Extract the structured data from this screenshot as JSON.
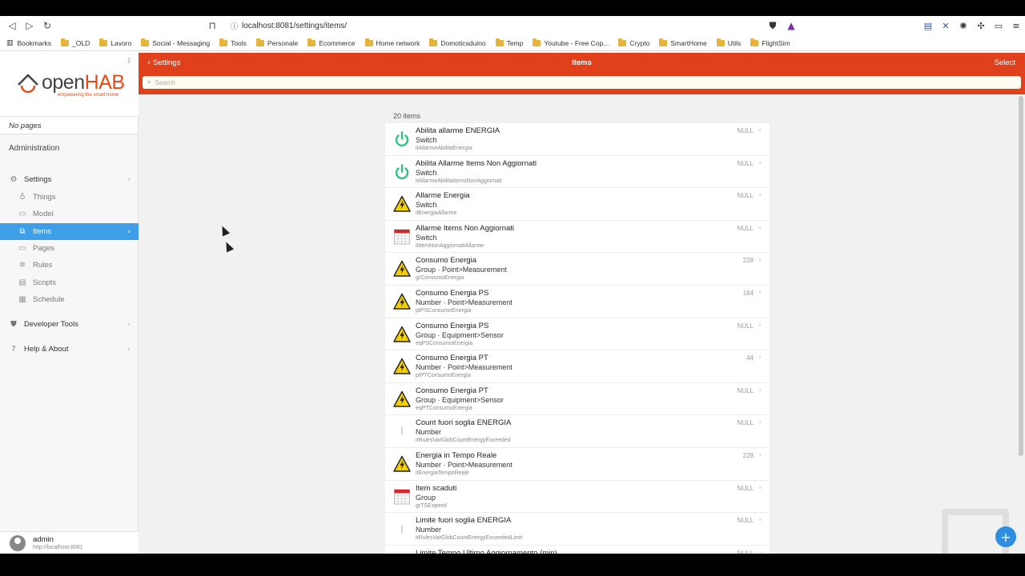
{
  "browser": {
    "url": "localhost:8081/settings/items/",
    "bookmarks": [
      "Bookmarks",
      "_OLD",
      "Lavoro",
      "Social - Messaging",
      "Tools",
      "Personale",
      "Ecommerce",
      "Home network",
      "Domoticsduino",
      "Temp",
      "Youtube - Free Cop...",
      "Crypto",
      "SmartHome",
      "Utils",
      "FlightSim"
    ]
  },
  "sidebar": {
    "logo_prefix": "open",
    "logo_suffix": "HAB",
    "logo_tagline": "empowering the smart home",
    "no_pages": "No pages",
    "section_title": "Administration",
    "settings_label": "Settings",
    "sub_items": [
      {
        "label": "Things",
        "icon": "bulb-icon"
      },
      {
        "label": "Model",
        "icon": "model-icon"
      },
      {
        "label": "Items",
        "icon": "items-icon"
      },
      {
        "label": "Pages",
        "icon": "pages-icon"
      },
      {
        "label": "Rules",
        "icon": "rules-icon"
      },
      {
        "label": "Scripts",
        "icon": "scripts-icon"
      },
      {
        "label": "Schedule",
        "icon": "calendar-icon"
      }
    ],
    "developer_tools": "Developer Tools",
    "help_about": "Help & About",
    "user_name": "admin",
    "user_url": "http://localhost:8081"
  },
  "appbar": {
    "back_label": "Settings",
    "title": "Items",
    "select_label": "Select",
    "search_placeholder": "Search"
  },
  "items_count": "20 items",
  "items": [
    {
      "name": "Abilita allarme ENERGIA",
      "type": "Switch",
      "id": "itAllarmeAbilitaEnergia",
      "state": "NULL",
      "icon": "power"
    },
    {
      "name": "Abilita Allarme Items Non Aggiornati",
      "type": "Switch",
      "id": "itAllarmeAbilitaItemsNonAggiornati",
      "state": "NULL",
      "icon": "power"
    },
    {
      "name": "Allarme Energia",
      "type": "Switch",
      "id": "itEnergiaAllarme",
      "state": "NULL",
      "icon": "warning"
    },
    {
      "name": "Allarme Items Non Aggiornati",
      "type": "Switch",
      "id": "itItemNonAggiornatiAllarme",
      "state": "NULL",
      "icon": "calendar"
    },
    {
      "name": "Consumo Energia",
      "type": "Group · Point>Measurement",
      "id": "grConsumoEnergia",
      "state": "228",
      "icon": "warning"
    },
    {
      "name": "Consumo Energia PS",
      "type": "Number · Point>Measurement",
      "id": "ptPSConsumoEnergia",
      "state": "184",
      "icon": "warning"
    },
    {
      "name": "Consumo Energia PS",
      "type": "Group · Equipment>Sensor",
      "id": "eqPSConsumoEnergia",
      "state": "NULL",
      "icon": "warning"
    },
    {
      "name": "Consumo Energia PT",
      "type": "Number · Point>Measurement",
      "id": "ptPTConsumoEnergia",
      "state": "44",
      "icon": "warning"
    },
    {
      "name": "Consumo Energia PT",
      "type": "Group · Equipment>Sensor",
      "id": "eqPTConsumoEnergia",
      "state": "NULL",
      "icon": "warning"
    },
    {
      "name": "Count fuori soglia ENERGIA",
      "type": "Number",
      "id": "itRulesVarGlobCountEnergyExceeded",
      "state": "NULL",
      "icon": "none"
    },
    {
      "name": "Energia in Tempo Reale",
      "type": "Number · Point>Measurement",
      "id": "itEnergiaTempoReale",
      "state": "228",
      "icon": "warning"
    },
    {
      "name": "Item scaduti",
      "type": "Group",
      "id": "grTSExpired",
      "state": "NULL",
      "icon": "calendar"
    },
    {
      "name": "Limite fuori soglia ENERGIA",
      "type": "Number",
      "id": "itRulesVarGlobCountEnergyExceededLimit",
      "state": "NULL",
      "icon": "none"
    },
    {
      "name": "Limite Tempo Ultimo Aggiornamento (min)",
      "type": "",
      "id": "",
      "state": "NULL",
      "icon": "none"
    }
  ]
}
